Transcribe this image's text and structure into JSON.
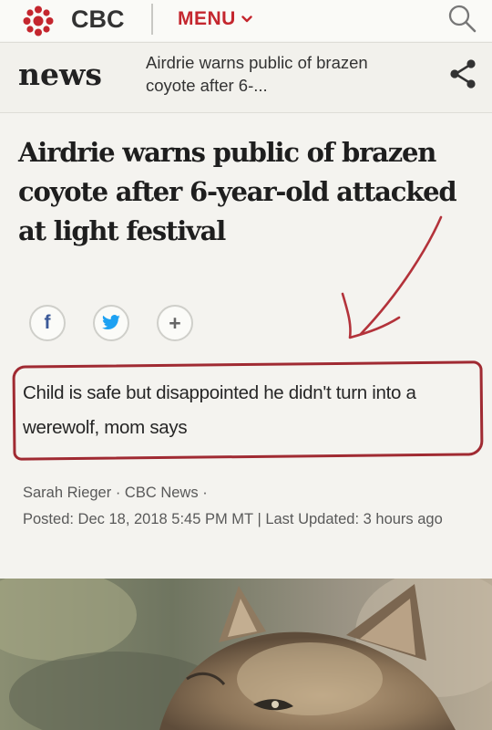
{
  "header": {
    "brand": "CBC",
    "menu_label": "MENU",
    "icons": [
      "cbc-gem-icon",
      "chevron-down-icon",
      "search-icon"
    ]
  },
  "subheader": {
    "section": "news",
    "short_title": "Airdrie warns public of brazen coyote after 6-...",
    "icons": [
      "share-icon"
    ]
  },
  "article": {
    "headline": "Airdrie warns public of brazen coyote after 6-year-old attacked at light festival",
    "deck": "Child is safe but disappointed he didn't turn into a werewolf, mom says",
    "author": "Sarah Rieger",
    "source": "CBC News",
    "posted_line": "Posted: Dec 18, 2018 5:45 PM MT",
    "updated_line": "Last Updated: 3 hours ago"
  },
  "social": {
    "facebook_glyph": "f",
    "plus_glyph": "+",
    "icons": [
      "facebook-icon",
      "twitter-icon",
      "plus-icon"
    ]
  },
  "colors": {
    "brand_red": "#c4262e",
    "annotation_red": "#a02a32",
    "facebook": "#3b5998",
    "twitter": "#1da1f2"
  }
}
